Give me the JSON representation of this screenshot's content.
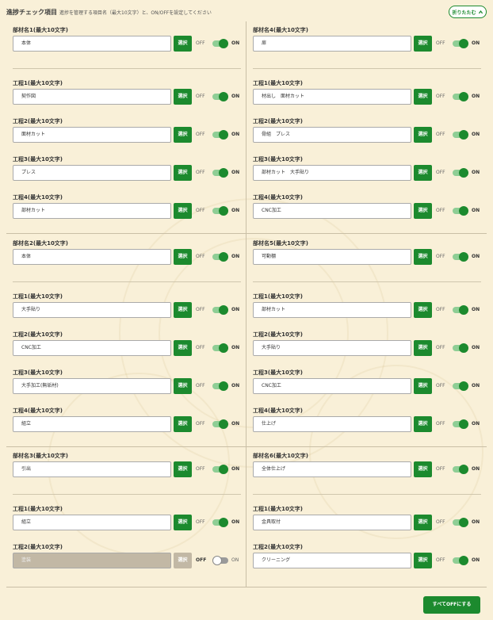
{
  "header": {
    "title": "進捗チェック項目",
    "description": "進捗を管理する項目名（最大10文字）と、ON/OFFを設定してください",
    "fold_label": "折りたたむ"
  },
  "labels": {
    "select": "選択",
    "off": "OFF",
    "on": "ON"
  },
  "colors": {
    "accent": "#1c8a2e",
    "background": "#f9f0d8"
  },
  "groups": [
    {
      "part": {
        "label": "部材名1(最大10文字)",
        "value": "本体",
        "state": "on"
      },
      "steps": [
        {
          "label": "工程1(最大10文字)",
          "value": "契作図",
          "state": "on"
        },
        {
          "label": "工程2(最大10文字)",
          "value": "面材カット",
          "state": "on"
        },
        {
          "label": "工程3(最大10文字)",
          "value": "プレス",
          "state": "on"
        },
        {
          "label": "工程4(最大10文字)",
          "value": "部材カット",
          "state": "on"
        }
      ]
    },
    {
      "part": {
        "label": "部材名4(最大10文字)",
        "value": "扉",
        "state": "on"
      },
      "steps": [
        {
          "label": "工程1(最大10文字)",
          "value": "材出し　面材カット",
          "state": "on"
        },
        {
          "label": "工程2(最大10文字)",
          "value": "骨組　プレス",
          "state": "on"
        },
        {
          "label": "工程3(最大10文字)",
          "value": "部材カット　大手貼り",
          "state": "on"
        },
        {
          "label": "工程4(最大10文字)",
          "value": "CNC加工",
          "state": "on"
        }
      ]
    },
    {
      "part": {
        "label": "部材名2(最大10文字)",
        "value": "本体",
        "state": "on"
      },
      "steps": [
        {
          "label": "工程1(最大10文字)",
          "value": "大手貼り",
          "state": "on"
        },
        {
          "label": "工程2(最大10文字)",
          "value": "CNC加工",
          "state": "on"
        },
        {
          "label": "工程3(最大10文字)",
          "value": "大手加工(無垢材)",
          "state": "on"
        },
        {
          "label": "工程4(最大10文字)",
          "value": "組立",
          "state": "on"
        }
      ]
    },
    {
      "part": {
        "label": "部材名5(最大10文字)",
        "value": "可動棚",
        "state": "on"
      },
      "steps": [
        {
          "label": "工程1(最大10文字)",
          "value": "部材カット",
          "state": "on"
        },
        {
          "label": "工程2(最大10文字)",
          "value": "大手貼り",
          "state": "on"
        },
        {
          "label": "工程3(最大10文字)",
          "value": "CNC加工",
          "state": "on"
        },
        {
          "label": "工程4(最大10文字)",
          "value": "仕上げ",
          "state": "on"
        }
      ]
    },
    {
      "part": {
        "label": "部材名3(最大10文字)",
        "value": "引出",
        "state": "on"
      },
      "steps": [
        {
          "label": "工程1(最大10文字)",
          "value": "組立",
          "state": "on"
        },
        {
          "label": "工程2(最大10文字)",
          "value": "塗装",
          "state": "off"
        }
      ]
    },
    {
      "part": {
        "label": "部材名6(最大10文字)",
        "value": "全体仕上げ",
        "state": "on"
      },
      "steps": [
        {
          "label": "工程1(最大10文字)",
          "value": "金具取付",
          "state": "on"
        },
        {
          "label": "工程2(最大10文字)",
          "value": "クリーニング",
          "state": "on"
        }
      ]
    }
  ],
  "footer": {
    "all_off_label": "すべてOFFにする"
  }
}
